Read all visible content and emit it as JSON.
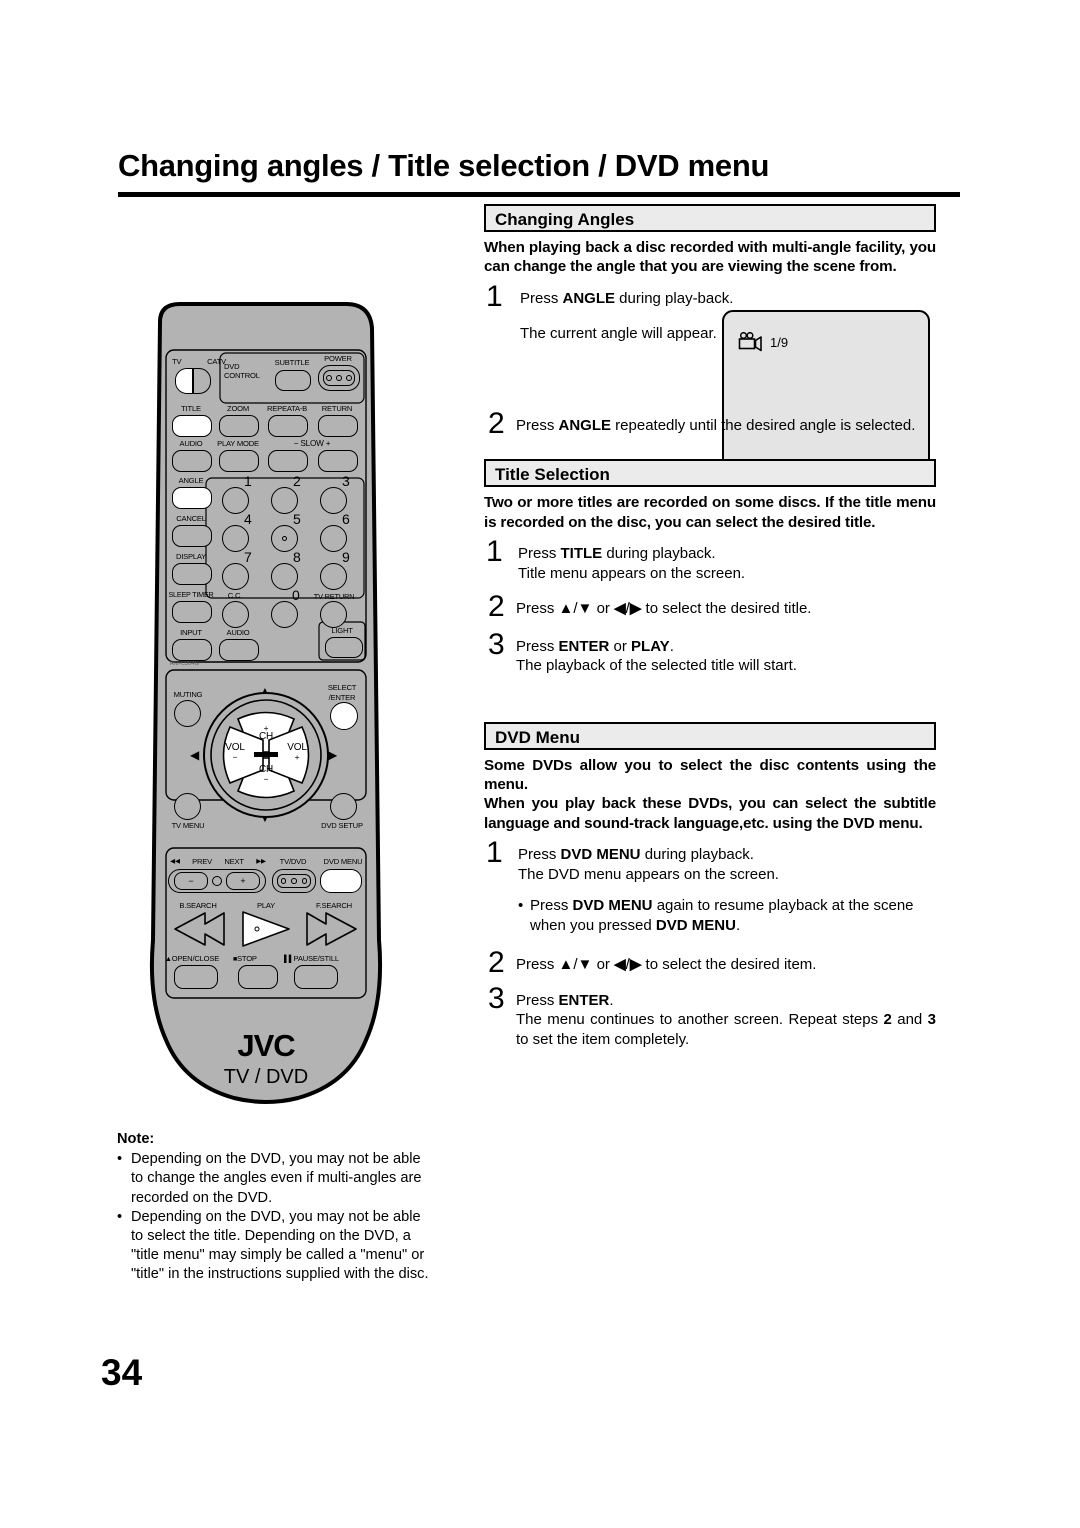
{
  "page": {
    "title": "Changing angles / Title selection / DVD menu",
    "number": "34"
  },
  "sections": {
    "changing_angles": {
      "heading": "Changing Angles",
      "intro": "When playing back a disc recorded with multi-angle facility, you can change the angle that you are viewing the scene from.",
      "step1_num": "1",
      "step1_line1_a": "Press ",
      "step1_line1_b": "ANGLE",
      "step1_line1_c": " during play-back.",
      "step1_note": "The current angle will appear.",
      "step2_num": "2",
      "step2_a": "Press ",
      "step2_b": "ANGLE",
      "step2_c": " repeatedly until the desired angle is selected."
    },
    "osd": {
      "icon": "video-camera-angle-icon",
      "text": "1/9"
    },
    "title_selection": {
      "heading": "Title Selection",
      "intro": "Two or more titles are recorded on some discs. If the title menu is recorded on the disc, you can select the desired title.",
      "step1_num": "1",
      "step1_a": "Press ",
      "step1_b": "TITLE",
      "step1_c": " during playback.",
      "step1_note": "Title menu appears on the screen.",
      "step2_num": "2",
      "step2_a": "Press ",
      "step2_arrows_up": "▲",
      "step2_slash1": "/",
      "step2_arrows_down": "▼",
      "step2_or": " or ",
      "step2_arrows_left": "◀",
      "step2_slash2": "/",
      "step2_arrows_right": "▶",
      "step2_c": " to select the desired title.",
      "step3_num": "3",
      "step3_a": "Press ",
      "step3_b": "ENTER",
      "step3_c": " or ",
      "step3_d": "PLAY",
      "step3_e": ".",
      "step3_note": "The playback of the selected title will start."
    },
    "dvd_menu": {
      "heading": "DVD Menu",
      "intro_1": "Some DVDs allow you to select the disc contents using the menu.",
      "intro_2": "When you play back these DVDs, you can select the subtitle language and sound-track language,etc. using the DVD menu.",
      "step1_num": "1",
      "step1_a": "Press ",
      "step1_b": "DVD MENU",
      "step1_c": " during playback.",
      "step1_note": "The DVD menu appears on the screen.",
      "bullet_dot": "•",
      "bullet_a": "Press ",
      "bullet_b": "DVD MENU",
      "bullet_c": " again to resume playback at the scene when you pressed ",
      "bullet_d": "DVD MENU",
      "bullet_e": ".",
      "step2_num": "2",
      "step2_a": "Press ",
      "step2_c": " to select the desired item.",
      "step3_num": "3",
      "step3_a": "Press ",
      "step3_b": "ENTER",
      "step3_c": ".",
      "step3_note_a": "The menu continues to another screen. Repeat steps ",
      "step3_note_b": "2",
      "step3_note_c": " and ",
      "step3_note_d": "3",
      "step3_note_e": " to set the item completely."
    }
  },
  "note": {
    "title": "Note:",
    "bullet_dot": "•",
    "items": [
      "Depending on the DVD, you may not be able to change the angles even if multi-angles are recorded on the DVD.",
      "Depending on the DVD, you may not be able to select the title. Depending on the DVD, a \"title menu\" may simply be called a \"menu\" or \"title\" in the instructions supplied with the disc."
    ]
  },
  "remote": {
    "brand": "JVC",
    "subbrand": "TV / DVD",
    "model": "RM-C304G",
    "labels": {
      "tv": "TV",
      "catv": "CATV",
      "dvd_control": "DVD\nCONTROL",
      "dvd_control_line1": "DVD",
      "dvd_control_line2": "CONTROL",
      "subtitle": "SUBTITLE",
      "power": "POWER",
      "title": "TITLE",
      "zoom": "ZOOM",
      "repeat_ab": "REPEATA-B",
      "return": "RETURN",
      "audio": "AUDIO",
      "play_mode": "PLAY MODE",
      "slow": "− SLOW +",
      "angle": "ANGLE",
      "cancel": "CANCEL",
      "display": "DISPLAY",
      "sleep_timer": "SLEEP TIMER",
      "cc": "C.C.",
      "tv_return": "TV RETURN",
      "input": "INPUT",
      "audio2": "AUDIO",
      "light": "LIGHT",
      "muting": "MUTING",
      "select_enter_l1": "SELECT",
      "select_enter_l2": "/ENTER",
      "tv_menu": "TV MENU",
      "dvd_setup": "DVD SETUP",
      "ch_plus_sym": "+",
      "ch_plus": "CH",
      "ch_minus": "CH",
      "ch_minus_sym": "−",
      "vol_left": "VOL",
      "vol_left_sym": "−",
      "vol_right": "VOL",
      "vol_right_sym": "+",
      "prev": "PREV",
      "prev_icon": "◀◀",
      "next": "NEXT",
      "next_icon": "▶▶",
      "tv_dvd": "TV/DVD",
      "dvd_menu": "DVD MENU",
      "b_search": "B.SEARCH",
      "play": "PLAY",
      "f_search": "F.SEARCH",
      "open_close": "OPEN/CLOSE",
      "stop": "STOP",
      "pause_still": "PAUSE/STILL",
      "minus": "−",
      "plus": "+"
    },
    "keypad": [
      "1",
      "2",
      "3",
      "4",
      "5",
      "6",
      "7",
      "8",
      "9",
      "0"
    ],
    "highlighted_buttons": [
      "TITLE",
      "ANGLE",
      "SELECT/ENTER",
      "DVD MENU",
      "PLAY"
    ]
  }
}
